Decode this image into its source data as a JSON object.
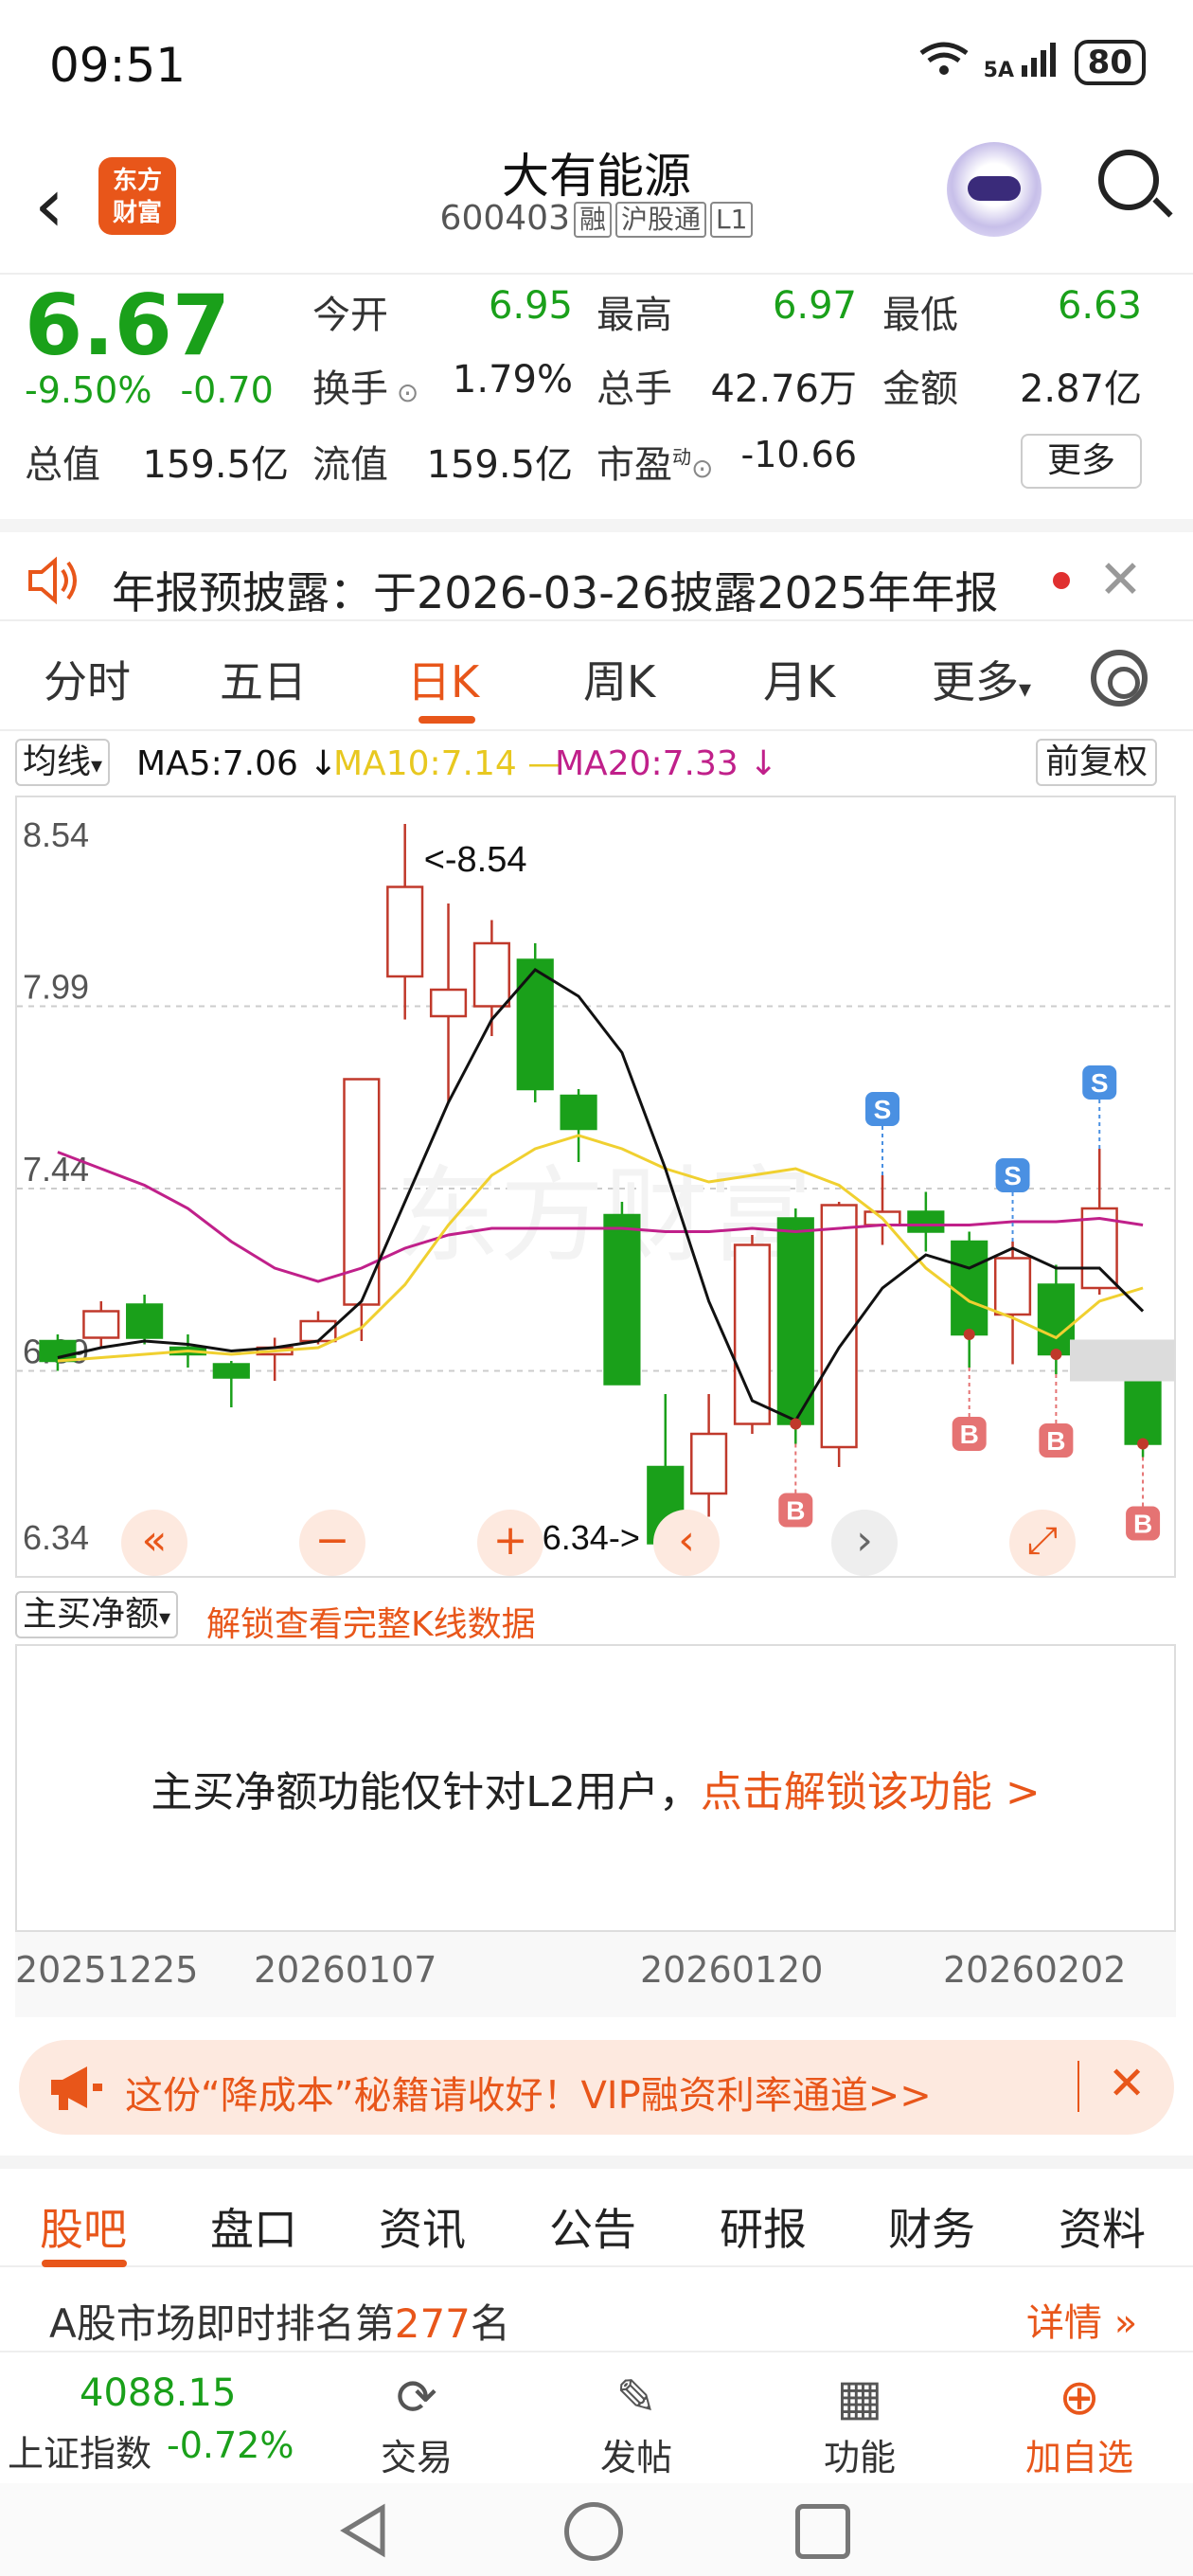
{
  "status_bar": {
    "time": "09:51",
    "network": "5A",
    "battery": "80"
  },
  "header": {
    "logo_text_1": "东方",
    "logo_text_2": "财富",
    "stock_name": "大有能源",
    "stock_code": "600403",
    "tags": [
      "融",
      "沪股通",
      "L1"
    ]
  },
  "quote": {
    "price": "6.67",
    "change_pct": "-9.50%",
    "change_amt": "-0.70",
    "open_label": "今开",
    "open": "6.95",
    "high_label": "最高",
    "high": "6.97",
    "low_label": "最低",
    "low": "6.63",
    "turnover_label": "换手",
    "turnover": "1.79%",
    "volume_label": "总手",
    "volume": "42.76万",
    "amount_label": "金额",
    "amount": "2.87亿",
    "total_cap_label": "总值",
    "total_cap": "159.5亿",
    "float_cap_label": "流值",
    "float_cap": "159.5亿",
    "pe_label": "市盈",
    "pe_sup": "动",
    "pe": "-10.66",
    "more_label": "更多"
  },
  "notice": {
    "text": "年报预披露：于2026-03-26披露2025年年报"
  },
  "tabs": [
    "分时",
    "五日",
    "日K",
    "周K",
    "月K",
    "更多"
  ],
  "ma": {
    "selector": "均线",
    "ma5": "MA5:7.06",
    "ma10": "MA10:7.14",
    "ma20": "MA20:7.33",
    "adjust": "前复权",
    "colors": {
      "ma5": "#111111",
      "ma10": "#f0d030",
      "ma20": "#c0208a"
    }
  },
  "chart_data": {
    "type": "candlestick",
    "y_ticks": [
      "8.54",
      "7.99",
      "7.44",
      "6.89",
      "6.34"
    ],
    "ylim": [
      6.34,
      8.54
    ],
    "high_label": "<-8.54",
    "low_label": "6.34->",
    "x_labels": [
      "20251225",
      "20260107",
      "20260120",
      "20260202"
    ],
    "candles": [
      {
        "o": 6.98,
        "c": 6.92,
        "h": 7.0,
        "l": 6.89
      },
      {
        "o": 6.99,
        "c": 7.07,
        "h": 7.1,
        "l": 6.96
      },
      {
        "o": 7.09,
        "c": 6.99,
        "h": 7.12,
        "l": 6.97
      },
      {
        "o": 6.96,
        "c": 6.94,
        "h": 7.0,
        "l": 6.9
      },
      {
        "o": 6.91,
        "c": 6.87,
        "h": 6.92,
        "l": 6.78
      },
      {
        "o": 6.94,
        "c": 6.96,
        "h": 6.99,
        "l": 6.86
      },
      {
        "o": 6.98,
        "c": 7.04,
        "h": 7.07,
        "l": 6.97
      },
      {
        "o": 7.09,
        "c": 7.77,
        "h": 7.77,
        "l": 6.98
      },
      {
        "o": 8.08,
        "c": 8.35,
        "h": 8.54,
        "l": 7.95
      },
      {
        "o": 7.96,
        "c": 8.04,
        "h": 8.3,
        "l": 7.7
      },
      {
        "o": 7.99,
        "c": 8.18,
        "h": 8.25,
        "l": 7.9
      },
      {
        "o": 8.13,
        "c": 7.74,
        "h": 8.18,
        "l": 7.7
      },
      {
        "o": 7.72,
        "c": 7.62,
        "h": 7.74,
        "l": 7.52
      },
      {
        "o": 7.36,
        "c": 6.85,
        "h": 7.4,
        "l": 6.85
      },
      {
        "o": 6.6,
        "c": 6.37,
        "h": 6.82,
        "l": 6.34
      },
      {
        "o": 6.52,
        "c": 6.7,
        "h": 6.82,
        "l": 6.45
      },
      {
        "o": 6.73,
        "c": 7.27,
        "h": 7.3,
        "l": 6.7
      },
      {
        "o": 7.35,
        "c": 6.73,
        "h": 7.38,
        "l": 6.67
      },
      {
        "o": 6.66,
        "c": 7.39,
        "h": 7.4,
        "l": 6.6
      },
      {
        "o": 7.33,
        "c": 7.37,
        "h": 7.48,
        "l": 7.27
      },
      {
        "o": 7.37,
        "c": 7.31,
        "h": 7.43,
        "l": 7.25
      },
      {
        "o": 7.28,
        "c": 7.0,
        "h": 7.31,
        "l": 6.9
      },
      {
        "o": 7.06,
        "c": 7.23,
        "h": 7.28,
        "l": 6.91
      },
      {
        "o": 7.15,
        "c": 6.94,
        "h": 7.21,
        "l": 6.88
      },
      {
        "o": 7.14,
        "c": 7.38,
        "h": 7.56,
        "l": 7.12
      },
      {
        "o": 6.95,
        "c": 6.67,
        "h": 6.97,
        "l": 6.63
      }
    ],
    "ma5": [
      6.93,
      6.96,
      6.98,
      6.97,
      6.95,
      6.96,
      6.98,
      7.1,
      7.4,
      7.7,
      7.95,
      8.1,
      8.02,
      7.85,
      7.5,
      7.1,
      6.8,
      6.74,
      6.96,
      7.14,
      7.24,
      7.2,
      7.26,
      7.2,
      7.2,
      7.07
    ],
    "ma10": [
      6.92,
      6.93,
      6.94,
      6.95,
      6.94,
      6.95,
      6.96,
      7.02,
      7.15,
      7.33,
      7.48,
      7.56,
      7.6,
      7.56,
      7.5,
      7.46,
      7.48,
      7.5,
      7.45,
      7.35,
      7.2,
      7.1,
      7.05,
      6.99,
      7.1,
      7.14
    ],
    "ma20": [
      7.55,
      7.5,
      7.45,
      7.38,
      7.28,
      7.2,
      7.16,
      7.2,
      7.26,
      7.3,
      7.32,
      7.32,
      7.32,
      7.32,
      7.31,
      7.31,
      7.32,
      7.31,
      7.32,
      7.33,
      7.33,
      7.33,
      7.34,
      7.34,
      7.35,
      7.33
    ],
    "signals": [
      {
        "i": 17,
        "type": "B"
      },
      {
        "i": 19,
        "type": "S"
      },
      {
        "i": 21,
        "type": "B"
      },
      {
        "i": 22,
        "type": "S"
      },
      {
        "i": 23,
        "type": "B"
      },
      {
        "i": 24,
        "type": "S"
      },
      {
        "i": 25,
        "type": "B"
      }
    ]
  },
  "chart_controls": {
    "prev_all": "«",
    "zoom_out": "−",
    "zoom_in": "+",
    "prev": "‹",
    "next": "›",
    "fullscreen": "⤢"
  },
  "indicator": {
    "selector": "主买净额",
    "unlock_link": "解锁查看完整K线数据",
    "message": "主买净额功能仅针对L2用户，",
    "message_link": "点击解锁该功能 >"
  },
  "vip_banner": {
    "text": "这份“降成本”秘籍请收好！VIP融资利率通道>>"
  },
  "bottom_tabs": [
    "股吧",
    "盘口",
    "资讯",
    "公告",
    "研报",
    "财务",
    "资料"
  ],
  "rank": {
    "prefix": "A股市场即时排名第",
    "rank": "277",
    "suffix": "名",
    "detail": "详情 »"
  },
  "footer": {
    "index_value": "4088.15",
    "index_name": "上证指数",
    "index_change": "-0.72%",
    "buttons": [
      "交易",
      "发帖",
      "功能",
      "加自选"
    ]
  }
}
